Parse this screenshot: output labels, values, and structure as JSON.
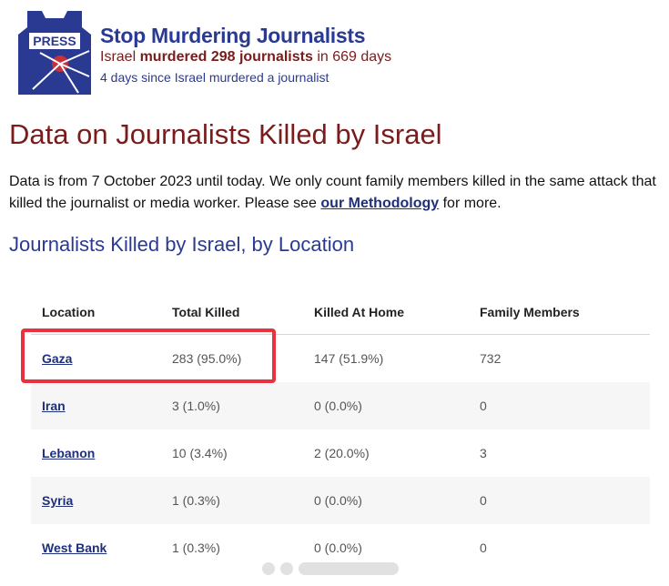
{
  "header": {
    "logo_text": "PRESS",
    "title": "Stop Murdering Journalists",
    "tagline_pre": "Israel ",
    "tagline_bold": "murdered 298 journalists",
    "tagline_post": " in 669 days",
    "since": "4 days since Israel murdered a journalist"
  },
  "main": {
    "title": "Data on Journalists Killed by Israel",
    "intro_pre": "Data is from 7 October 2023 until today. We only count family members killed in the same attack that killed the journalist or media worker. Please see ",
    "intro_link": "our Methodology",
    "intro_post": " for more.",
    "section_title": "Journalists Killed by Israel, by Location"
  },
  "table": {
    "headers": [
      "Location",
      "Total Killed",
      "Killed At Home",
      "Family Members"
    ],
    "rows": [
      {
        "location": "Gaza",
        "total": "283 (95.0%)",
        "home": "147 (51.9%)",
        "family": "732"
      },
      {
        "location": "Iran",
        "total": "3 (1.0%)",
        "home": "0 (0.0%)",
        "family": "0"
      },
      {
        "location": "Lebanon",
        "total": "10 (3.4%)",
        "home": "2 (20.0%)",
        "family": "3"
      },
      {
        "location": "Syria",
        "total": "1 (0.3%)",
        "home": "0 (0.0%)",
        "family": "0"
      },
      {
        "location": "West Bank",
        "total": "1 (0.3%)",
        "home": "0 (0.0%)",
        "family": "0"
      }
    ]
  },
  "colors": {
    "brand_blue": "#2a3a93",
    "brand_red": "#7a1c1c",
    "highlight": "#e8333f"
  }
}
